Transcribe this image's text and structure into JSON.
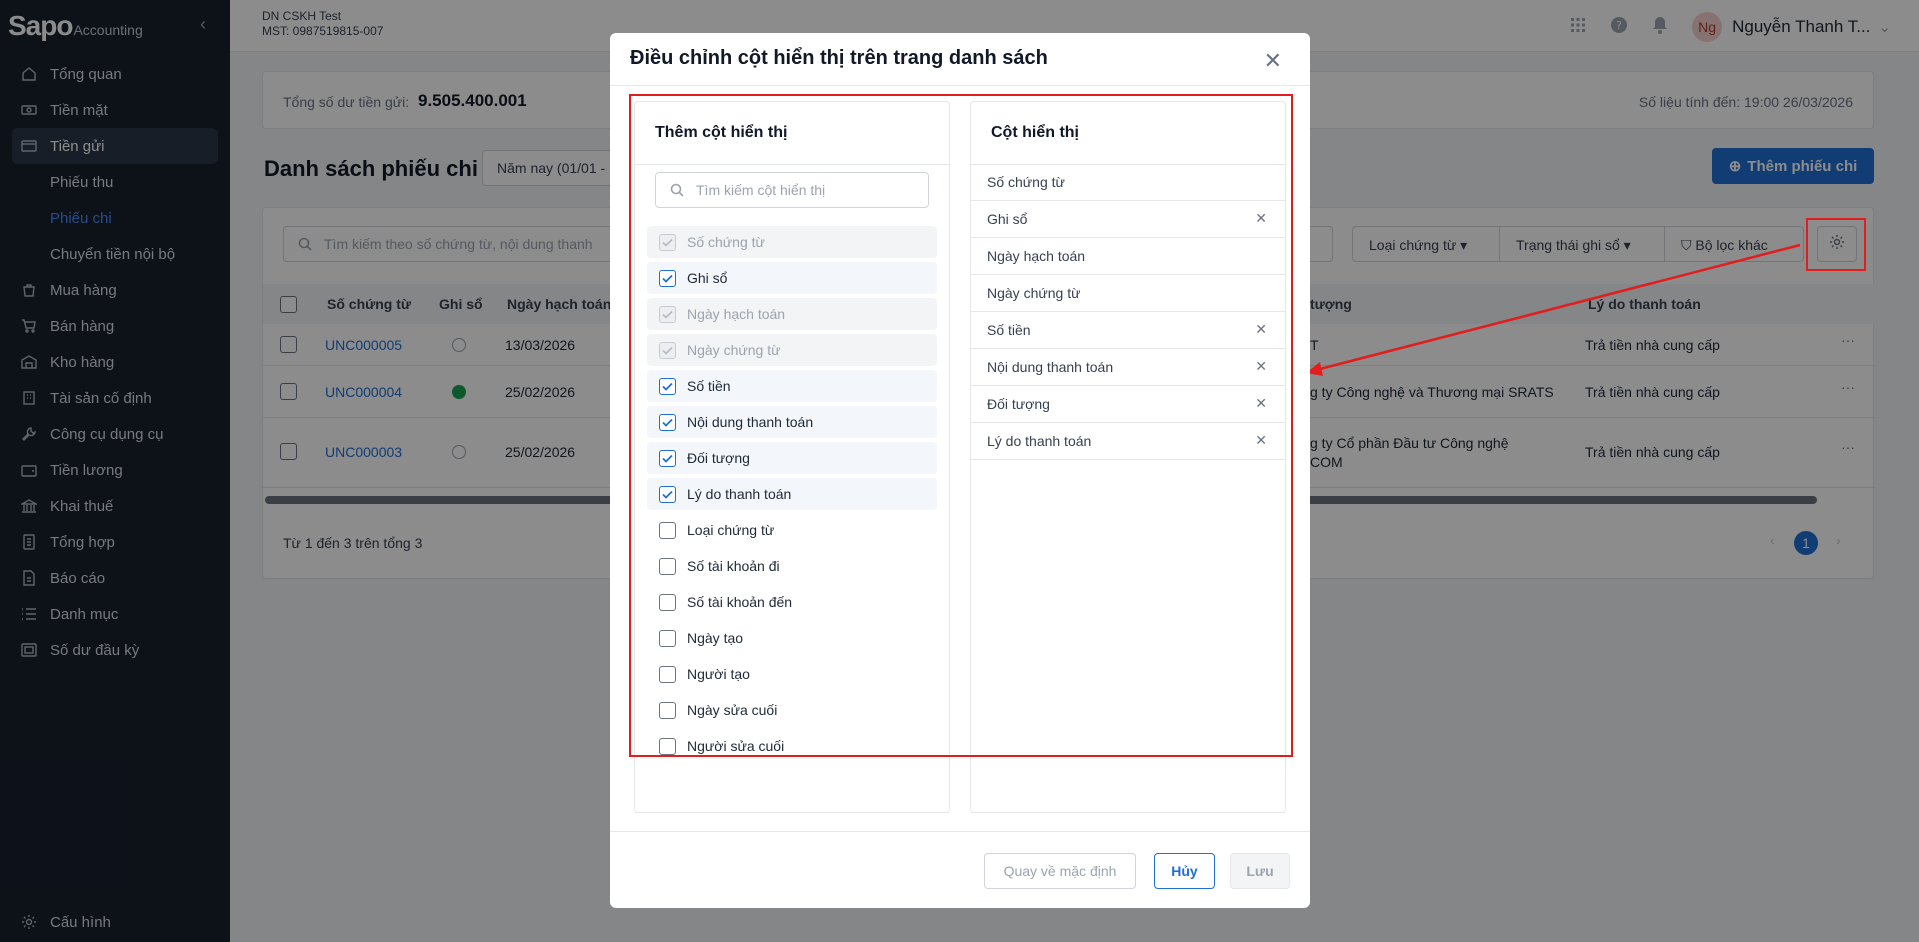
{
  "app": {
    "logo_main": "Sapo",
    "logo_sub": "Accounting",
    "collapse_icon": "chevron-left-icon"
  },
  "sidebar": {
    "items": [
      {
        "label": "Tổng quan",
        "icon": "home-icon"
      },
      {
        "label": "Tiền mặt",
        "icon": "cash-icon"
      },
      {
        "label": "Tiền gửi",
        "icon": "card-icon",
        "active": true
      },
      {
        "label": "Mua hàng",
        "icon": "bag-icon"
      },
      {
        "label": "Bán hàng",
        "icon": "cart-icon"
      },
      {
        "label": "Kho hàng",
        "icon": "warehouse-icon"
      },
      {
        "label": "Tài sản cố định",
        "icon": "building-icon"
      },
      {
        "label": "Công cụ dụng cụ",
        "icon": "tool-icon"
      },
      {
        "label": "Tiền lương",
        "icon": "wallet-icon"
      },
      {
        "label": "Khai thuế",
        "icon": "bank-icon"
      },
      {
        "label": "Tổng hợp",
        "icon": "ledger-icon"
      },
      {
        "label": "Báo cáo",
        "icon": "report-icon"
      },
      {
        "label": "Danh mục",
        "icon": "list-icon"
      },
      {
        "label": "Số dư đầu kỳ",
        "icon": "balance-icon"
      }
    ],
    "sub_items": [
      "Phiếu thu",
      "Phiếu chi",
      "Chuyển tiền nội bộ"
    ],
    "config_label": "Cấu hình"
  },
  "header": {
    "company_name": "DN CSKH Test",
    "tax_code": "MST: 0987519815-007",
    "avatar_initials": "Ng",
    "user_name": "Nguyễn Thanh T..."
  },
  "balance": {
    "label": "Tổng số dư tiền gửi:",
    "value": "9.505.400.001",
    "as_of": "Số liệu tính đến: 19:00 26/03/2026"
  },
  "page": {
    "title": "Danh sách phiếu chi",
    "period": "Năm nay (01/01 -",
    "add_button": "Thêm phiếu chi"
  },
  "list": {
    "search_placeholder": "Tìm kiếm theo số chứng từ, nội dung thanh",
    "filters": [
      "Loại chứng từ",
      "Trạng thái ghi sổ",
      "Bộ lọc khác"
    ],
    "columns": [
      "Số chứng từ",
      "Ghi sổ",
      "Ngày hạch toán",
      "tượng",
      "Lý do thanh toán"
    ],
    "rows": [
      {
        "code": "UNC000005",
        "posted": false,
        "date": "13/03/2026",
        "party": "T",
        "party2": "",
        "reason": "Trả tiền nhà cung cấp"
      },
      {
        "code": "UNC000004",
        "posted": true,
        "date": "25/02/2026",
        "party": "g ty Công nghệ và Thương mại SRATS",
        "party2": "",
        "reason": "Trả tiền nhà cung cấp"
      },
      {
        "code": "UNC000003",
        "posted": false,
        "date": "25/02/2026",
        "party": "g ty Cổ phần Đầu tư Công nghệ",
        "party2": "COM",
        "reason": "Trả tiền nhà cung cấp"
      }
    ],
    "summary": "Từ 1 đến 3 trên tổng 3",
    "current_page": "1"
  },
  "modal": {
    "title": "Điều chỉnh cột hiển thị trên trang danh sách",
    "add_panel_title": "Thêm cột hiển thị",
    "search_placeholder": "Tìm kiếm cột hiển thị",
    "options": [
      {
        "label": "Số chứng từ",
        "state": "locked"
      },
      {
        "label": "Ghi sổ",
        "state": "checked"
      },
      {
        "label": "Ngày hạch toán",
        "state": "locked"
      },
      {
        "label": "Ngày chứng từ",
        "state": "locked"
      },
      {
        "label": "Số tiền",
        "state": "checked"
      },
      {
        "label": "Nội dung thanh toán",
        "state": "checked"
      },
      {
        "label": "Đối tượng",
        "state": "checked"
      },
      {
        "label": "Lý do thanh toán",
        "state": "checked"
      },
      {
        "label": "Loại chứng từ",
        "state": "unchecked"
      },
      {
        "label": "Số tài khoản đi",
        "state": "unchecked"
      },
      {
        "label": "Số tài khoản đến",
        "state": "unchecked"
      },
      {
        "label": "Ngày tạo",
        "state": "unchecked"
      },
      {
        "label": "Người tạo",
        "state": "unchecked"
      },
      {
        "label": "Ngày sửa cuối",
        "state": "unchecked"
      },
      {
        "label": "Người sửa cuối",
        "state": "unchecked"
      }
    ],
    "shown_panel_title": "Cột hiển thị",
    "shown_columns": [
      {
        "label": "Số chứng từ",
        "removable": false
      },
      {
        "label": "Ghi sổ",
        "removable": true
      },
      {
        "label": "Ngày hạch toán",
        "removable": false
      },
      {
        "label": "Ngày chứng từ",
        "removable": false
      },
      {
        "label": "Số tiền",
        "removable": true
      },
      {
        "label": "Nội dung thanh toán",
        "removable": true
      },
      {
        "label": "Đối tượng",
        "removable": true
      },
      {
        "label": "Lý do thanh toán",
        "removable": true
      }
    ],
    "reset_button": "Quay về mặc định",
    "cancel_button": "Hủy",
    "save_button": "Lưu"
  },
  "colors": {
    "sidebar_bg": "#18212f",
    "primary": "#1f6ed4",
    "annotation_red": "#e11d1d",
    "posted_green": "#1aa053"
  }
}
